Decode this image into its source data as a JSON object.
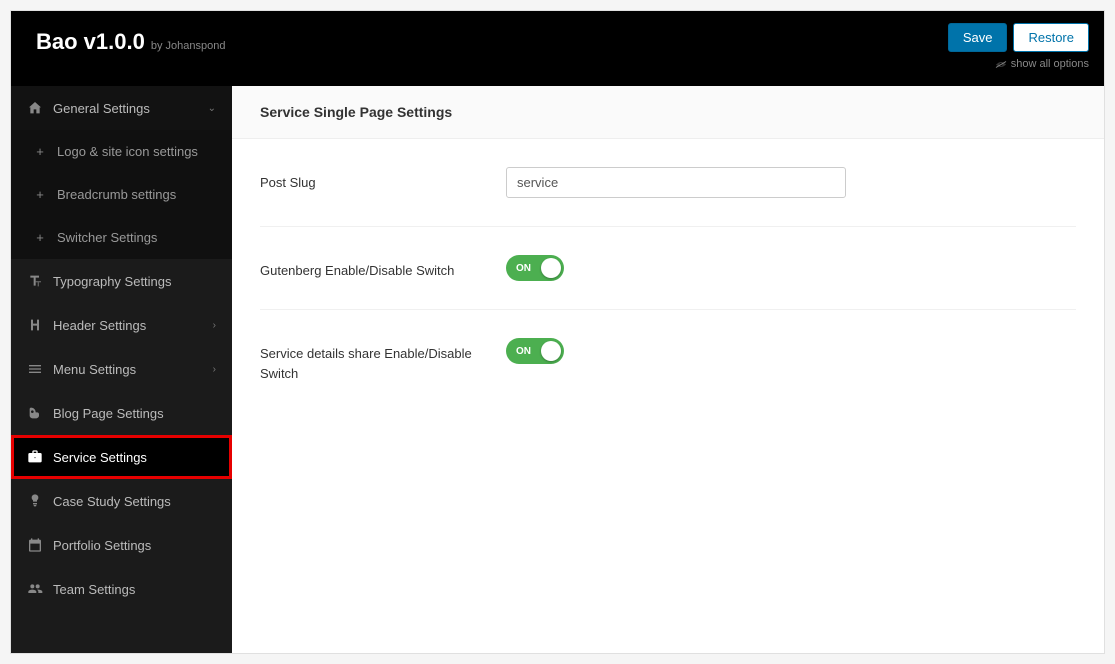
{
  "header": {
    "brand_name": "Bao v1.0.0",
    "brand_author": "by Johanspond",
    "save_label": "Save",
    "restore_label": "Restore",
    "show_all_label": "show all options"
  },
  "sidebar": {
    "items": [
      {
        "label": "General Settings",
        "expanded": true
      },
      {
        "label": "Logo & site icon settings"
      },
      {
        "label": "Breadcrumb settings"
      },
      {
        "label": "Switcher Settings"
      },
      {
        "label": "Typography Settings"
      },
      {
        "label": "Header Settings"
      },
      {
        "label": "Menu Settings"
      },
      {
        "label": "Blog Page Settings"
      },
      {
        "label": "Service Settings",
        "active": true
      },
      {
        "label": "Case Study Settings"
      },
      {
        "label": "Portfolio Settings"
      },
      {
        "label": "Team Settings"
      }
    ]
  },
  "content": {
    "title": "Service Single Page Settings",
    "post_slug_label": "Post Slug",
    "post_slug_value": "service",
    "gutenberg_label": "Gutenberg Enable/Disable Switch",
    "gutenberg_state": "ON",
    "share_label": "Service details share Enable/Disable Switch",
    "share_state": "ON"
  }
}
